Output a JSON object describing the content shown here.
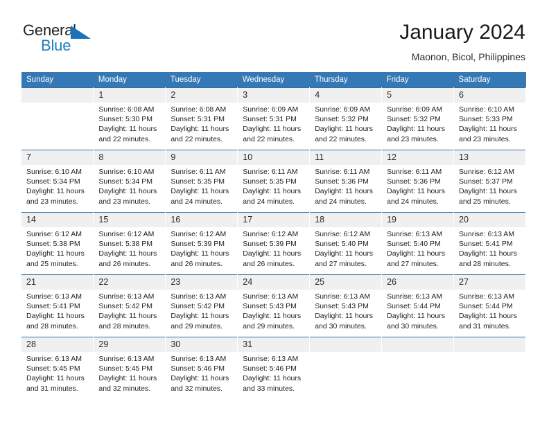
{
  "brand": {
    "name_part1": "General",
    "name_part2": "Blue",
    "triangle_color": "#1a72b8",
    "blue_text_color": "#1f7fc4"
  },
  "header": {
    "title": "January 2024",
    "location": "Maonon, Bicol, Philippines"
  },
  "theme": {
    "header_band": "#3479b5",
    "row_divider": "#2f6fa8",
    "daynum_band": "#f0f0f0",
    "text": "#1e1e1e"
  },
  "weekdays": [
    "Sunday",
    "Monday",
    "Tuesday",
    "Wednesday",
    "Thursday",
    "Friday",
    "Saturday"
  ],
  "labels": {
    "sunrise": "Sunrise:",
    "sunset": "Sunset:",
    "daylight": "Daylight:"
  },
  "weeks": [
    [
      {
        "day": "",
        "sunrise": "",
        "sunset": "",
        "daylight1": "",
        "daylight2": ""
      },
      {
        "day": "1",
        "sunrise": "Sunrise: 6:08 AM",
        "sunset": "Sunset: 5:30 PM",
        "daylight1": "Daylight: 11 hours",
        "daylight2": "and 22 minutes."
      },
      {
        "day": "2",
        "sunrise": "Sunrise: 6:08 AM",
        "sunset": "Sunset: 5:31 PM",
        "daylight1": "Daylight: 11 hours",
        "daylight2": "and 22 minutes."
      },
      {
        "day": "3",
        "sunrise": "Sunrise: 6:09 AM",
        "sunset": "Sunset: 5:31 PM",
        "daylight1": "Daylight: 11 hours",
        "daylight2": "and 22 minutes."
      },
      {
        "day": "4",
        "sunrise": "Sunrise: 6:09 AM",
        "sunset": "Sunset: 5:32 PM",
        "daylight1": "Daylight: 11 hours",
        "daylight2": "and 22 minutes."
      },
      {
        "day": "5",
        "sunrise": "Sunrise: 6:09 AM",
        "sunset": "Sunset: 5:32 PM",
        "daylight1": "Daylight: 11 hours",
        "daylight2": "and 23 minutes."
      },
      {
        "day": "6",
        "sunrise": "Sunrise: 6:10 AM",
        "sunset": "Sunset: 5:33 PM",
        "daylight1": "Daylight: 11 hours",
        "daylight2": "and 23 minutes."
      }
    ],
    [
      {
        "day": "7",
        "sunrise": "Sunrise: 6:10 AM",
        "sunset": "Sunset: 5:34 PM",
        "daylight1": "Daylight: 11 hours",
        "daylight2": "and 23 minutes."
      },
      {
        "day": "8",
        "sunrise": "Sunrise: 6:10 AM",
        "sunset": "Sunset: 5:34 PM",
        "daylight1": "Daylight: 11 hours",
        "daylight2": "and 23 minutes."
      },
      {
        "day": "9",
        "sunrise": "Sunrise: 6:11 AM",
        "sunset": "Sunset: 5:35 PM",
        "daylight1": "Daylight: 11 hours",
        "daylight2": "and 24 minutes."
      },
      {
        "day": "10",
        "sunrise": "Sunrise: 6:11 AM",
        "sunset": "Sunset: 5:35 PM",
        "daylight1": "Daylight: 11 hours",
        "daylight2": "and 24 minutes."
      },
      {
        "day": "11",
        "sunrise": "Sunrise: 6:11 AM",
        "sunset": "Sunset: 5:36 PM",
        "daylight1": "Daylight: 11 hours",
        "daylight2": "and 24 minutes."
      },
      {
        "day": "12",
        "sunrise": "Sunrise: 6:11 AM",
        "sunset": "Sunset: 5:36 PM",
        "daylight1": "Daylight: 11 hours",
        "daylight2": "and 24 minutes."
      },
      {
        "day": "13",
        "sunrise": "Sunrise: 6:12 AM",
        "sunset": "Sunset: 5:37 PM",
        "daylight1": "Daylight: 11 hours",
        "daylight2": "and 25 minutes."
      }
    ],
    [
      {
        "day": "14",
        "sunrise": "Sunrise: 6:12 AM",
        "sunset": "Sunset: 5:38 PM",
        "daylight1": "Daylight: 11 hours",
        "daylight2": "and 25 minutes."
      },
      {
        "day": "15",
        "sunrise": "Sunrise: 6:12 AM",
        "sunset": "Sunset: 5:38 PM",
        "daylight1": "Daylight: 11 hours",
        "daylight2": "and 26 minutes."
      },
      {
        "day": "16",
        "sunrise": "Sunrise: 6:12 AM",
        "sunset": "Sunset: 5:39 PM",
        "daylight1": "Daylight: 11 hours",
        "daylight2": "and 26 minutes."
      },
      {
        "day": "17",
        "sunrise": "Sunrise: 6:12 AM",
        "sunset": "Sunset: 5:39 PM",
        "daylight1": "Daylight: 11 hours",
        "daylight2": "and 26 minutes."
      },
      {
        "day": "18",
        "sunrise": "Sunrise: 6:12 AM",
        "sunset": "Sunset: 5:40 PM",
        "daylight1": "Daylight: 11 hours",
        "daylight2": "and 27 minutes."
      },
      {
        "day": "19",
        "sunrise": "Sunrise: 6:13 AM",
        "sunset": "Sunset: 5:40 PM",
        "daylight1": "Daylight: 11 hours",
        "daylight2": "and 27 minutes."
      },
      {
        "day": "20",
        "sunrise": "Sunrise: 6:13 AM",
        "sunset": "Sunset: 5:41 PM",
        "daylight1": "Daylight: 11 hours",
        "daylight2": "and 28 minutes."
      }
    ],
    [
      {
        "day": "21",
        "sunrise": "Sunrise: 6:13 AM",
        "sunset": "Sunset: 5:41 PM",
        "daylight1": "Daylight: 11 hours",
        "daylight2": "and 28 minutes."
      },
      {
        "day": "22",
        "sunrise": "Sunrise: 6:13 AM",
        "sunset": "Sunset: 5:42 PM",
        "daylight1": "Daylight: 11 hours",
        "daylight2": "and 28 minutes."
      },
      {
        "day": "23",
        "sunrise": "Sunrise: 6:13 AM",
        "sunset": "Sunset: 5:42 PM",
        "daylight1": "Daylight: 11 hours",
        "daylight2": "and 29 minutes."
      },
      {
        "day": "24",
        "sunrise": "Sunrise: 6:13 AM",
        "sunset": "Sunset: 5:43 PM",
        "daylight1": "Daylight: 11 hours",
        "daylight2": "and 29 minutes."
      },
      {
        "day": "25",
        "sunrise": "Sunrise: 6:13 AM",
        "sunset": "Sunset: 5:43 PM",
        "daylight1": "Daylight: 11 hours",
        "daylight2": "and 30 minutes."
      },
      {
        "day": "26",
        "sunrise": "Sunrise: 6:13 AM",
        "sunset": "Sunset: 5:44 PM",
        "daylight1": "Daylight: 11 hours",
        "daylight2": "and 30 minutes."
      },
      {
        "day": "27",
        "sunrise": "Sunrise: 6:13 AM",
        "sunset": "Sunset: 5:44 PM",
        "daylight1": "Daylight: 11 hours",
        "daylight2": "and 31 minutes."
      }
    ],
    [
      {
        "day": "28",
        "sunrise": "Sunrise: 6:13 AM",
        "sunset": "Sunset: 5:45 PM",
        "daylight1": "Daylight: 11 hours",
        "daylight2": "and 31 minutes."
      },
      {
        "day": "29",
        "sunrise": "Sunrise: 6:13 AM",
        "sunset": "Sunset: 5:45 PM",
        "daylight1": "Daylight: 11 hours",
        "daylight2": "and 32 minutes."
      },
      {
        "day": "30",
        "sunrise": "Sunrise: 6:13 AM",
        "sunset": "Sunset: 5:46 PM",
        "daylight1": "Daylight: 11 hours",
        "daylight2": "and 32 minutes."
      },
      {
        "day": "31",
        "sunrise": "Sunrise: 6:13 AM",
        "sunset": "Sunset: 5:46 PM",
        "daylight1": "Daylight: 11 hours",
        "daylight2": "and 33 minutes."
      },
      {
        "day": "",
        "sunrise": "",
        "sunset": "",
        "daylight1": "",
        "daylight2": ""
      },
      {
        "day": "",
        "sunrise": "",
        "sunset": "",
        "daylight1": "",
        "daylight2": ""
      },
      {
        "day": "",
        "sunrise": "",
        "sunset": "",
        "daylight1": "",
        "daylight2": ""
      }
    ]
  ]
}
